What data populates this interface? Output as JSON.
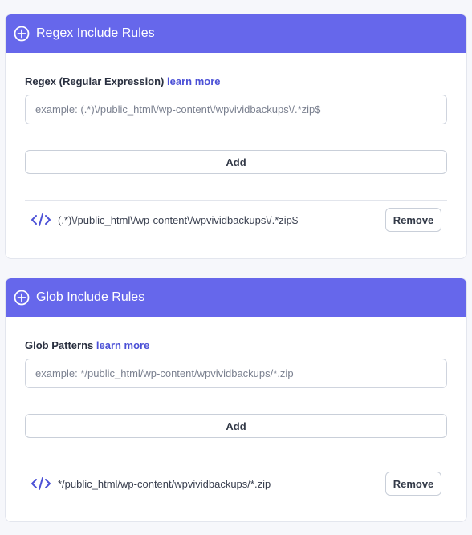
{
  "colors": {
    "header_bg": "#6667eb",
    "link": "#4b50d6",
    "icon_accent": "#4b50d6"
  },
  "regex_card": {
    "header_icon": "plus-circle-icon",
    "title": "Regex Include Rules",
    "label": "Regex (Regular Expression)",
    "learn_more": "learn more",
    "input_placeholder": "example: (.*)\\/public_html\\/wp-content\\/wpvividbackups\\/.*zip$",
    "input_value": "",
    "add_label": "Add",
    "rules": [
      {
        "icon": "code-icon",
        "text": "(.*)\\/public_html\\/wp-content\\/wpvividbackups\\/.*zip$",
        "remove_label": "Remove"
      }
    ]
  },
  "glob_card": {
    "header_icon": "plus-circle-icon",
    "title": "Glob Include Rules",
    "label": "Glob Patterns",
    "learn_more": "learn more",
    "input_placeholder": "example: */public_html/wp-content/wpvividbackups/*.zip",
    "input_value": "",
    "add_label": "Add",
    "rules": [
      {
        "icon": "code-icon",
        "text": "*/public_html/wp-content/wpvividbackups/*.zip",
        "remove_label": "Remove"
      }
    ]
  }
}
